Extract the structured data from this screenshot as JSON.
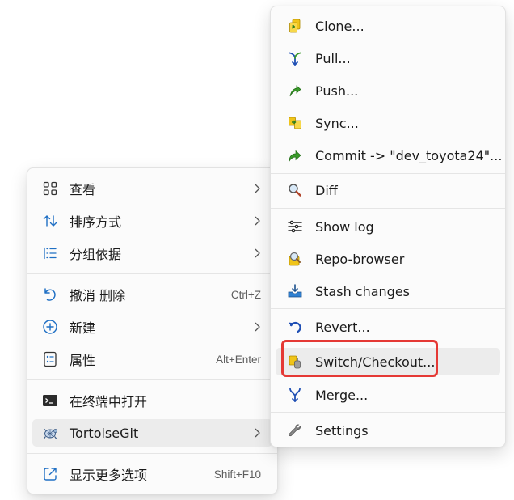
{
  "main_menu": {
    "items": [
      {
        "label": "查看",
        "icon": "grid-icon",
        "submenu": true
      },
      {
        "label": "排序方式",
        "icon": "sort-icon",
        "submenu": true
      },
      {
        "label": "分组依据",
        "icon": "group-list-icon",
        "submenu": true
      },
      {
        "label": "撤消 删除",
        "icon": "undo-icon",
        "shortcut": "Ctrl+Z"
      },
      {
        "label": "新建",
        "icon": "add-circle-icon",
        "submenu": true
      },
      {
        "label": "属性",
        "icon": "properties-icon",
        "shortcut": "Alt+Enter"
      },
      {
        "label": "在终端中打开",
        "icon": "terminal-icon"
      },
      {
        "label": "TortoiseGit",
        "icon": "tortoisegit-icon",
        "submenu": true,
        "highlighted": true
      },
      {
        "label": "显示更多选项",
        "icon": "open-external-icon",
        "shortcut": "Shift+F10"
      }
    ]
  },
  "sub_menu": {
    "items": [
      {
        "label": "Clone...",
        "icon": "clone-icon"
      },
      {
        "label": "Pull...",
        "icon": "pull-icon"
      },
      {
        "label": "Push...",
        "icon": "push-icon"
      },
      {
        "label": "Sync...",
        "icon": "sync-icon"
      },
      {
        "label": "Commit -> \"dev_toyota24\"...",
        "icon": "commit-icon"
      },
      {
        "label": "Diff",
        "icon": "magnifier-icon"
      },
      {
        "label": "Show log",
        "icon": "show-log-icon"
      },
      {
        "label": "Repo-browser",
        "icon": "repo-browser-icon"
      },
      {
        "label": "Stash changes",
        "icon": "stash-icon"
      },
      {
        "label": "Revert...",
        "icon": "revert-icon"
      },
      {
        "label": "Switch/Checkout...",
        "icon": "switch-checkout-icon",
        "highlighted": true
      },
      {
        "label": "Merge...",
        "icon": "merge-icon"
      },
      {
        "label": "Settings",
        "icon": "wrench-icon"
      }
    ]
  },
  "colors": {
    "menu_bg": "#fbfbfb",
    "hover_bg": "#ececec",
    "focus_outline": "#e53935",
    "fluent_blue": "#1f6fc4",
    "git_green": "#3a9a2a",
    "git_yellow": "#e8b400"
  }
}
